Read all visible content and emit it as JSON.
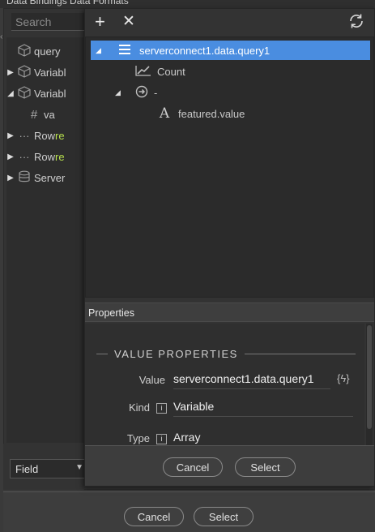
{
  "background": {
    "title": "Data Bindings   Data Formats",
    "search_placeholder": "Search",
    "tree": [
      {
        "arrow": "",
        "icon": "cube-icon",
        "label": "query",
        "highlight": ""
      },
      {
        "arrow": "▶",
        "icon": "cube-icon",
        "label": "Variabl",
        "highlight": ""
      },
      {
        "arrow": "◢",
        "icon": "cube-icon",
        "label": "Variabl",
        "highlight": ""
      },
      {
        "arrow": "",
        "icon": "hash-icon",
        "label": "va",
        "highlight": ""
      },
      {
        "arrow": "▶",
        "icon": "ellipsis-icon",
        "label": "Row ",
        "highlight": "re"
      },
      {
        "arrow": "▶",
        "icon": "ellipsis-icon",
        "label": "Row ",
        "highlight": "re"
      },
      {
        "arrow": "▶",
        "icon": "database-icon",
        "label": "Server",
        "highlight": ""
      }
    ],
    "select_value": "Field",
    "cancel_label": "Cancel",
    "select_label": "Select"
  },
  "dialog": {
    "tree": {
      "root": "serverconnect1.data.query1",
      "items": [
        {
          "label": "Count",
          "icon": "chart-line-icon"
        },
        {
          "label": "-",
          "icon": "arrow-circle-icon"
        },
        {
          "label": "featured.value",
          "icon": "text-a-icon"
        }
      ]
    },
    "properties_header": "Properties",
    "section_title": "VALUE PROPERTIES",
    "props": {
      "value_label": "Value",
      "value": "serverconnect1.data.query1",
      "kind_label": "Kind",
      "kind": "Variable",
      "type_label": "Type",
      "type": "Array"
    },
    "cancel_label": "Cancel",
    "select_label": "Select"
  },
  "colors": {
    "selection": "#4a8de0",
    "highlight_green": "#b7e04d"
  }
}
